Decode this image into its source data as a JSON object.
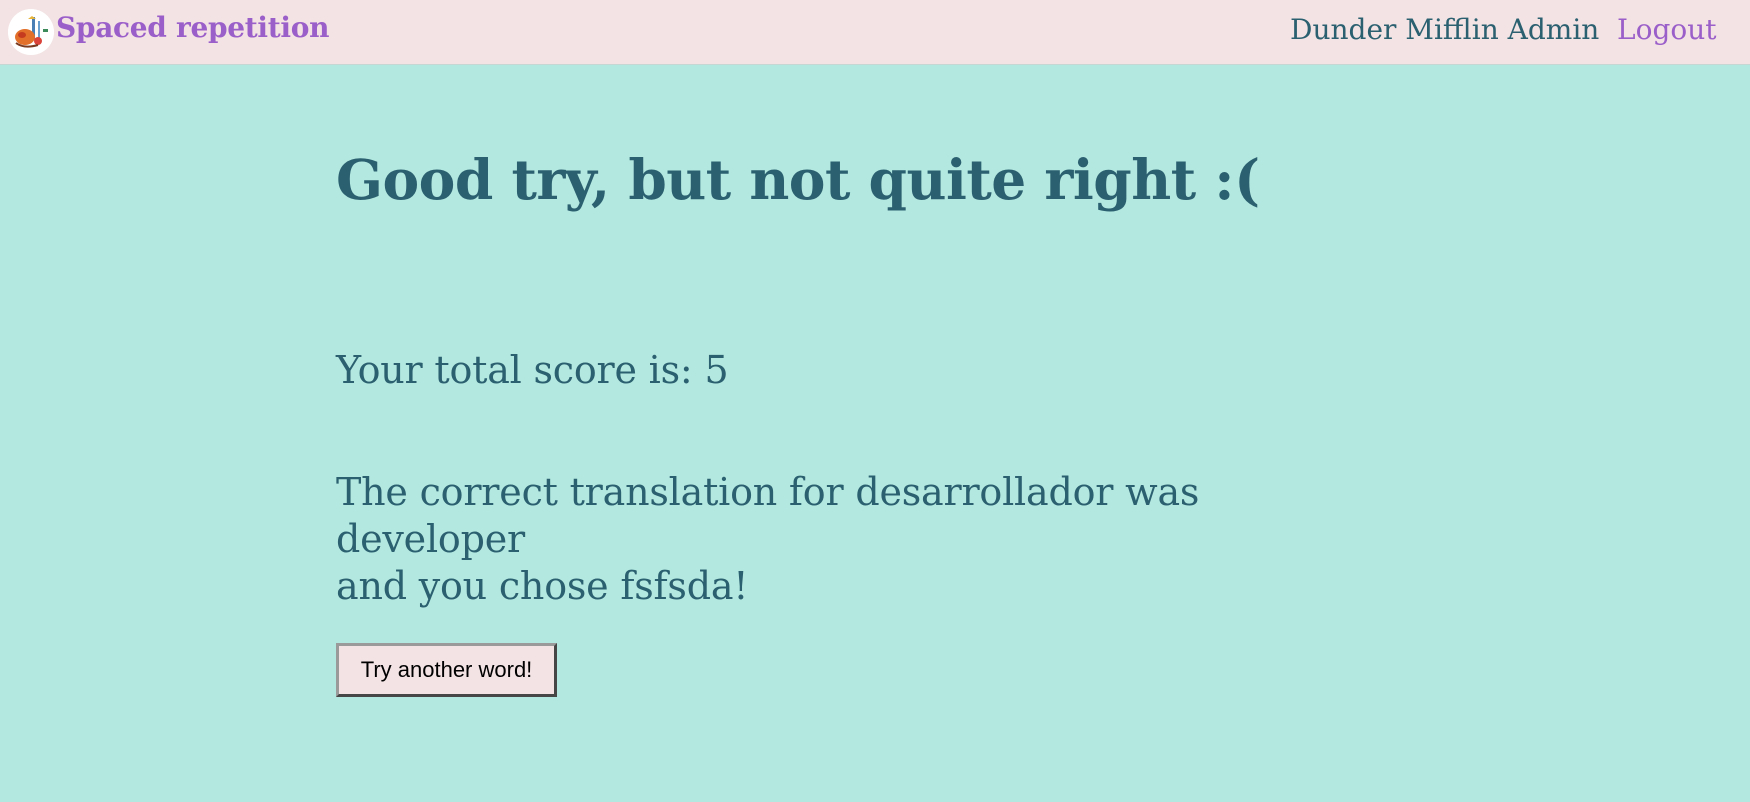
{
  "header": {
    "app_title": "Spaced repetition",
    "user_name": "Dunder Mifflin Admin",
    "logout_label": "Logout",
    "logo_icon": "app-logo-icon"
  },
  "main": {
    "headline": "Good try, but not quite right :(",
    "score_label": "Your total score is:",
    "score_value": "5",
    "feedback_prefix": "The correct translation for",
    "original_word": "desarrollador",
    "feedback_mid": "was",
    "correct_translation": "developer",
    "feedback_user_prefix": "and you chose",
    "user_guess": "fsfsda",
    "feedback_suffix": "!",
    "next_button_label": "Try another word!"
  },
  "colors": {
    "header_background": "#f3e3e4",
    "page_background": "#b3e8e0",
    "text": "#2b6070",
    "accent": "#9b5fc9"
  }
}
